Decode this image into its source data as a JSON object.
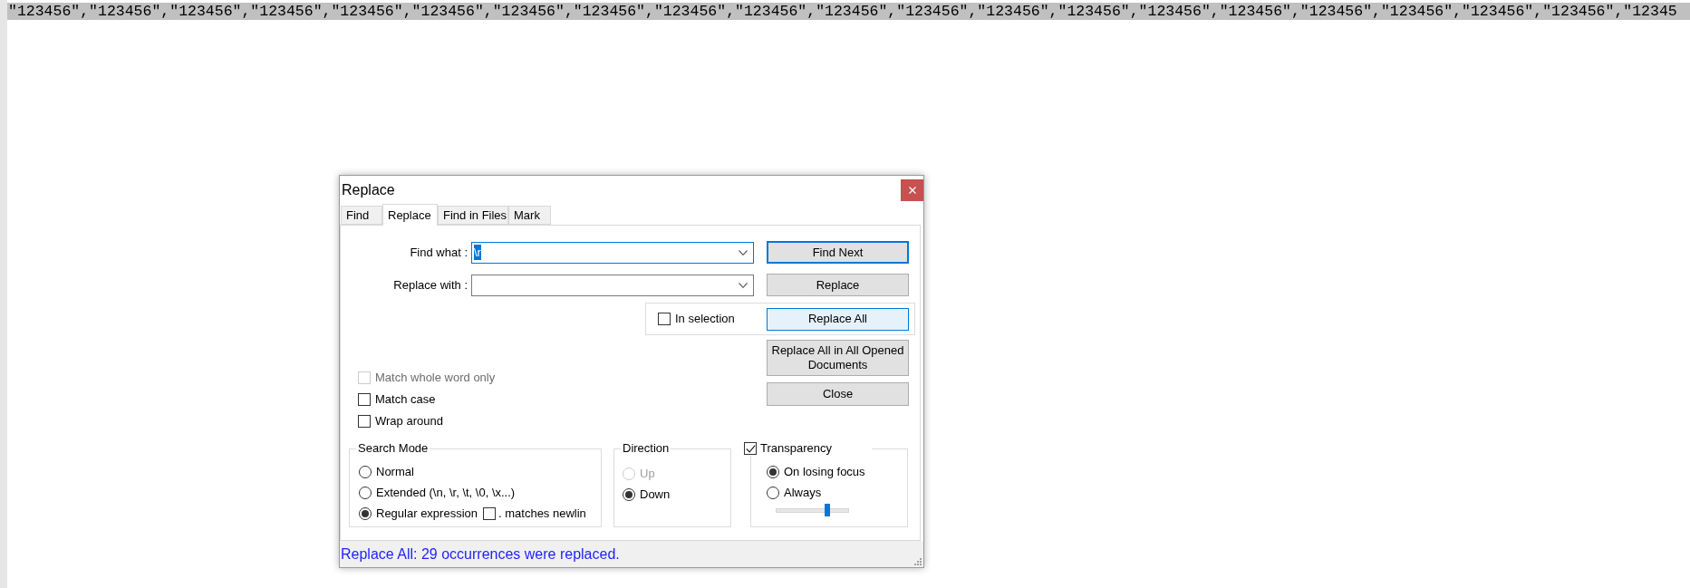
{
  "editor": {
    "lines": [
      {
        "text": "\"123456\",\"123456\",\"123456\",\"123456\",\"123456\",\"123456\",\"123456\",\"123456\",\"123456\",\"123456\",\"123456\",\"123456\",\"123456\",\"123456\",\"123456\",\"123456\",\"123456\",\"123456\",\"123456\",\"123456\",\"12345",
        "selected": true
      }
    ]
  },
  "dialog": {
    "title": "Replace",
    "tabs": [
      {
        "label": "Find",
        "selected": false
      },
      {
        "label": "Replace",
        "selected": true
      },
      {
        "label": "Find in Files",
        "selected": false
      },
      {
        "label": "Mark",
        "selected": false
      }
    ],
    "fields": [
      {
        "label": "Find what :",
        "value": "\\r",
        "value_selected": true,
        "focused": true
      },
      {
        "label": "Replace with :",
        "focused": false
      }
    ],
    "buttons": [
      {
        "label": "Find Next",
        "focused": true,
        "hovered": false
      },
      {
        "label": "Replace",
        "focused": false,
        "hovered": false
      },
      {
        "label": "Replace All",
        "focused": false,
        "hovered": true
      },
      {
        "label": "Replace All in All Opened Documents",
        "focused": false,
        "hovered": false
      },
      {
        "label": "Close",
        "focused": false,
        "hovered": false
      }
    ],
    "in_selection": {
      "label": "In selection",
      "checked": false
    },
    "options": [
      {
        "label": "Match whole word only",
        "checked": false,
        "disabled": true
      },
      {
        "label": "Match case",
        "checked": false,
        "disabled": false
      },
      {
        "label": "Wrap around",
        "checked": false,
        "disabled": false
      }
    ],
    "search_mode": {
      "title": "Search Mode",
      "options": [
        {
          "label": "Normal",
          "selected": false
        },
        {
          "label": "Extended (\\n, \\r, \\t, \\0, \\x...)",
          "selected": false
        },
        {
          "label": "Regular expression",
          "selected": true
        }
      ],
      "dot_matches_newline": {
        "label": ". matches newlin",
        "checked": false
      }
    },
    "direction": {
      "title": "Direction",
      "options": [
        {
          "label": "Up",
          "selected": false,
          "disabled": true
        },
        {
          "label": "Down",
          "selected": true,
          "disabled": false
        }
      ]
    },
    "transparency": {
      "label": "Transparency",
      "checked": true,
      "options": [
        {
          "label": "On losing focus",
          "selected": true
        },
        {
          "label": "Always",
          "selected": false
        }
      ],
      "level": 0.72
    },
    "status_bar": {
      "message": "Replace All: 29 occurrences were replaced."
    }
  }
}
